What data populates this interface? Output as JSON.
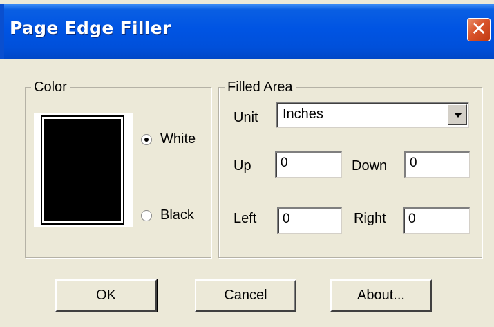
{
  "window": {
    "title": "Page Edge Filler",
    "close_glyph": "✕"
  },
  "color_group": {
    "legend": "Color",
    "options": [
      {
        "label": "White",
        "checked": true
      },
      {
        "label": "Black",
        "checked": false
      }
    ]
  },
  "filled_area": {
    "legend": "Filled Area",
    "unit_label": "Unit",
    "unit_value": "Inches",
    "up_label": "Up",
    "up_value": "0",
    "down_label": "Down",
    "down_value": "0",
    "left_label": "Left",
    "left_value": "0",
    "right_label": "Right",
    "right_value": "0"
  },
  "buttons": {
    "ok": "OK",
    "cancel": "Cancel",
    "about": "About..."
  }
}
